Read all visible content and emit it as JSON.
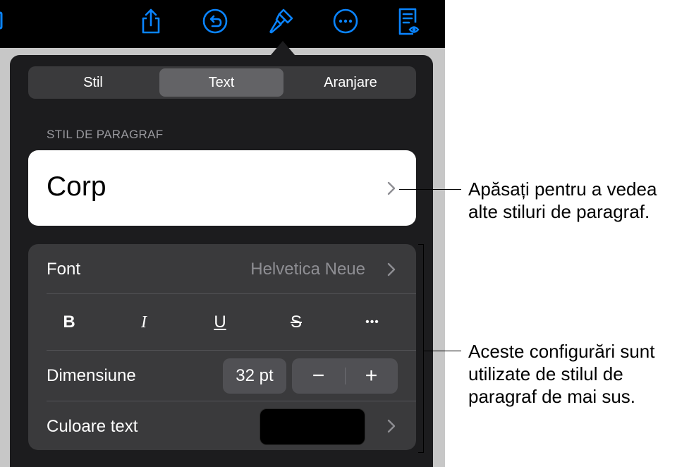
{
  "toolbar": {
    "icons": [
      "share-icon",
      "undo-icon",
      "format-brush-icon",
      "more-icon",
      "reader-view-icon"
    ]
  },
  "tabs": [
    {
      "label": "Stil",
      "active": false
    },
    {
      "label": "Text",
      "active": true
    },
    {
      "label": "Aranjare",
      "active": false
    }
  ],
  "paragraph_style": {
    "section_header": "STIL DE PARAGRAF",
    "current": "Corp"
  },
  "font_row": {
    "label": "Font",
    "value": "Helvetica Neue"
  },
  "format_buttons": [
    {
      "name": "bold",
      "glyph": "B"
    },
    {
      "name": "italic",
      "glyph": "I"
    },
    {
      "name": "underline",
      "glyph": "U"
    },
    {
      "name": "strikethrough",
      "glyph": "S"
    },
    {
      "name": "more",
      "glyph": "•••"
    }
  ],
  "size_row": {
    "label": "Dimensiune",
    "value": "32 pt",
    "decrement": "−",
    "increment": "+"
  },
  "color_row": {
    "label": "Culoare text",
    "swatch_color": "#000000"
  },
  "callouts": {
    "top": [
      "Apăsați pentru a vedea",
      "alte stiluri de paragraf."
    ],
    "bottom": [
      "Aceste configurări sunt",
      "utilizate de stilul de",
      "paragraf de mai sus."
    ]
  },
  "colors": {
    "accent": "#0a84ff",
    "popover_bg": "#1c1c1e",
    "group_bg": "#3a3a3c"
  }
}
